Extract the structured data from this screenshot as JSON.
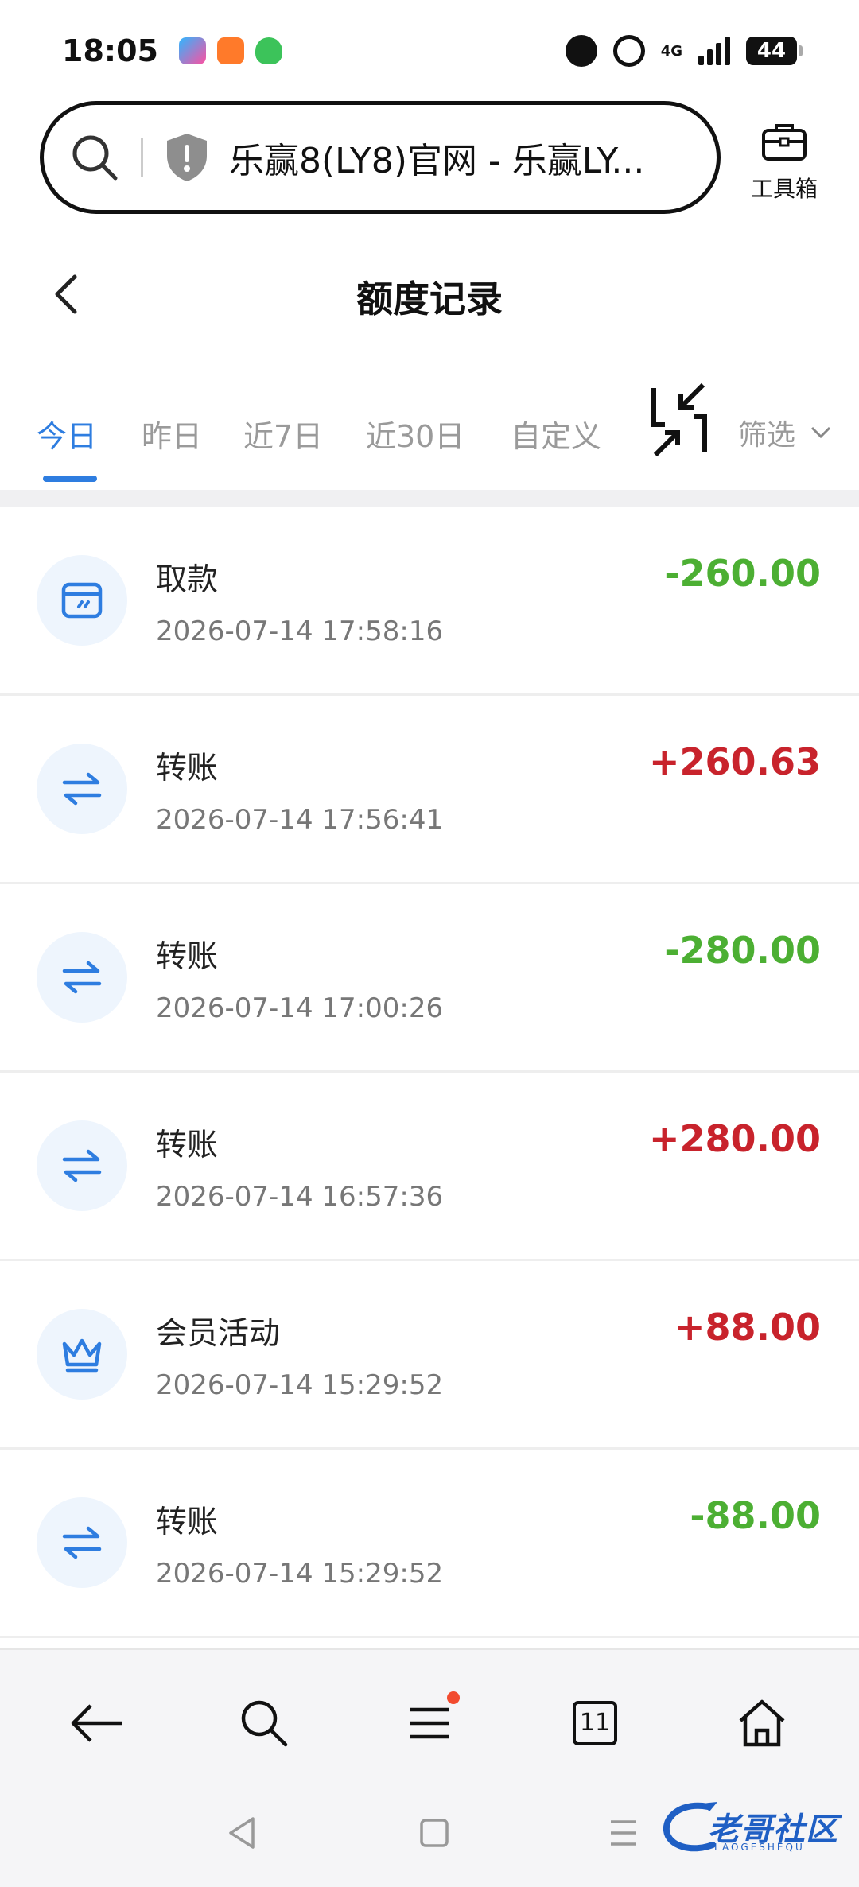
{
  "status_bar": {
    "time": "18:05",
    "network": "4G",
    "battery": "44"
  },
  "address_bar": {
    "url_title": "乐赢8(LY8)官网 - 乐赢LY..."
  },
  "toolbox": {
    "label": "工具箱"
  },
  "header": {
    "title": "额度记录"
  },
  "tabs": {
    "items": [
      "今日",
      "昨日",
      "近7日",
      "近30日",
      "自定义"
    ],
    "active": "今日",
    "filter_label": "筛选"
  },
  "records": [
    {
      "type": "取款",
      "time": "2026-07-14 17:58:16",
      "amount": "-260.00",
      "icon": "wallet-icon"
    },
    {
      "type": "转账",
      "time": "2026-07-14 17:56:41",
      "amount": "+260.63",
      "icon": "transfer-icon"
    },
    {
      "type": "转账",
      "time": "2026-07-14 17:00:26",
      "amount": "-280.00",
      "icon": "transfer-icon"
    },
    {
      "type": "转账",
      "time": "2026-07-14 16:57:36",
      "amount": "+280.00",
      "icon": "transfer-icon"
    },
    {
      "type": "会员活动",
      "time": "2026-07-14 15:29:52",
      "amount": "+88.00",
      "icon": "crown-icon"
    },
    {
      "type": "转账",
      "time": "2026-07-14 15:29:52",
      "amount": "-88.00",
      "icon": "transfer-icon"
    }
  ],
  "browser_bar": {
    "tab_count": "11"
  },
  "colors": {
    "accent": "#2e7de0",
    "negative": "#4caf33",
    "positive": "#c8232c",
    "icon_bg": "#eef5fd"
  },
  "watermark": {
    "text": "老哥社区",
    "sub": "LAOGESHEQU"
  }
}
